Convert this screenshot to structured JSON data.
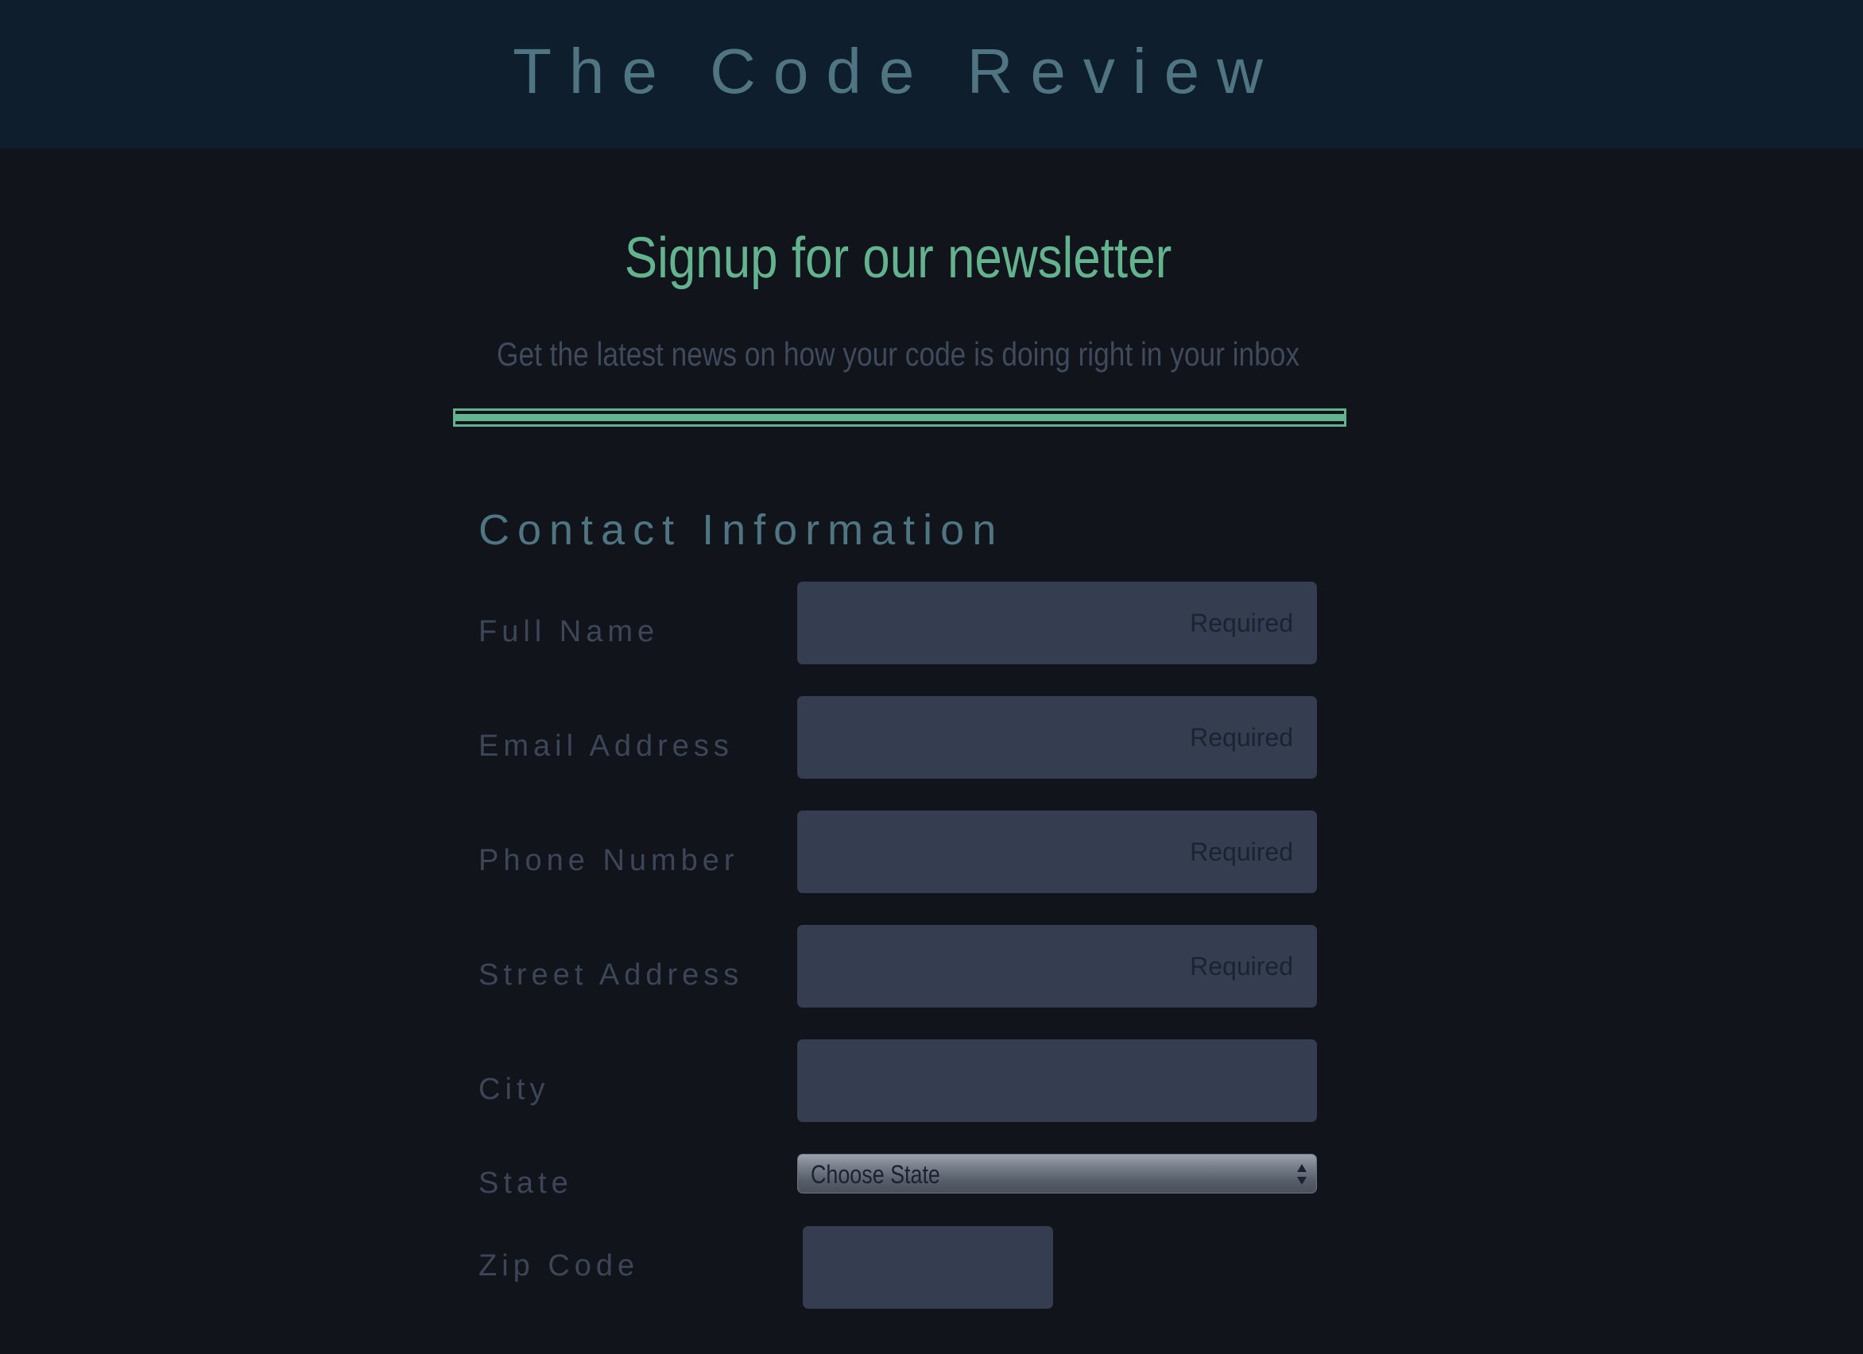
{
  "header": {
    "site_title": "The Code Review"
  },
  "hero": {
    "title": "Signup for our newsletter",
    "subtitle": "Get the latest news on how your code is doing right in your inbox"
  },
  "form": {
    "section_title": "Contact Information",
    "fields": {
      "full_name": {
        "label": "Full Name",
        "placeholder": "Required",
        "value": ""
      },
      "email": {
        "label": "Email Address",
        "placeholder": "Required",
        "value": ""
      },
      "phone": {
        "label": "Phone Number",
        "placeholder": "Required",
        "value": ""
      },
      "street": {
        "label": "Street Address",
        "placeholder": "Required",
        "value": ""
      },
      "city": {
        "label": "City",
        "placeholder": "",
        "value": ""
      },
      "state": {
        "label": "State",
        "selected": "Choose State"
      },
      "zip": {
        "label": "Zip Code",
        "placeholder": "",
        "value": ""
      }
    }
  },
  "colors": {
    "background": "#11141b",
    "header_background": "#0e1e2c",
    "accent": "#62b38e",
    "title_muted": "#4f7582",
    "label": "#3c4658",
    "input_background": "#353e50"
  }
}
